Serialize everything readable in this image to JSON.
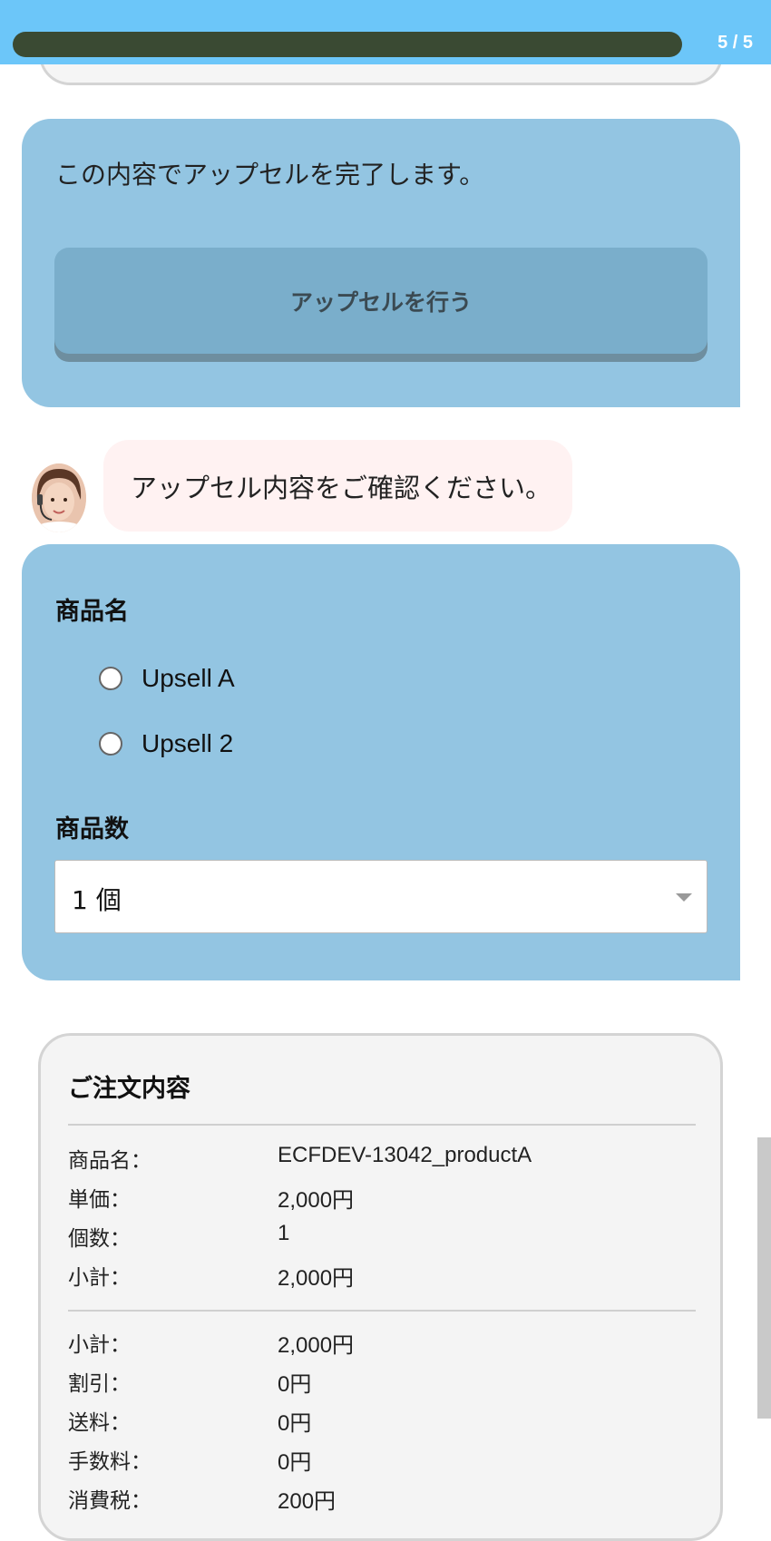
{
  "progress": {
    "count_text": "5 / 5",
    "fraction": 1.0
  },
  "confirm_panel": {
    "message": "この内容でアップセルを完了します。",
    "button_label": "アップセルを行う"
  },
  "bot": {
    "avatar_icon": "operator-avatar-icon",
    "message": "アップセル内容をご確認ください。"
  },
  "form": {
    "product_label": "商品名",
    "product_options": [
      "Upsell A",
      "Upsell 2"
    ],
    "quantity_label": "商品数",
    "quantity_value": "1 個"
  },
  "order": {
    "title": "ご注文内容",
    "items": [
      {
        "key": "商品名：",
        "value": "ECFDEV-13042_productA"
      },
      {
        "key": "単価：",
        "value": "2,000円"
      },
      {
        "key": "個数：",
        "value": "1"
      },
      {
        "key": "小計：",
        "value": "2,000円"
      }
    ],
    "totals": [
      {
        "key": "小計：",
        "value": "2,000円"
      },
      {
        "key": "割引：",
        "value": "0円"
      },
      {
        "key": "送料：",
        "value": "0円"
      },
      {
        "key": "手数料：",
        "value": "0円"
      },
      {
        "key": "消費税：",
        "value": "200円"
      }
    ]
  },
  "colors": {
    "topbar": "#6cc6f9",
    "progress_fill": "#3a4a33",
    "panel": "#93c5e2",
    "button": "#7aaecb",
    "bubble": "#fff2f2"
  }
}
